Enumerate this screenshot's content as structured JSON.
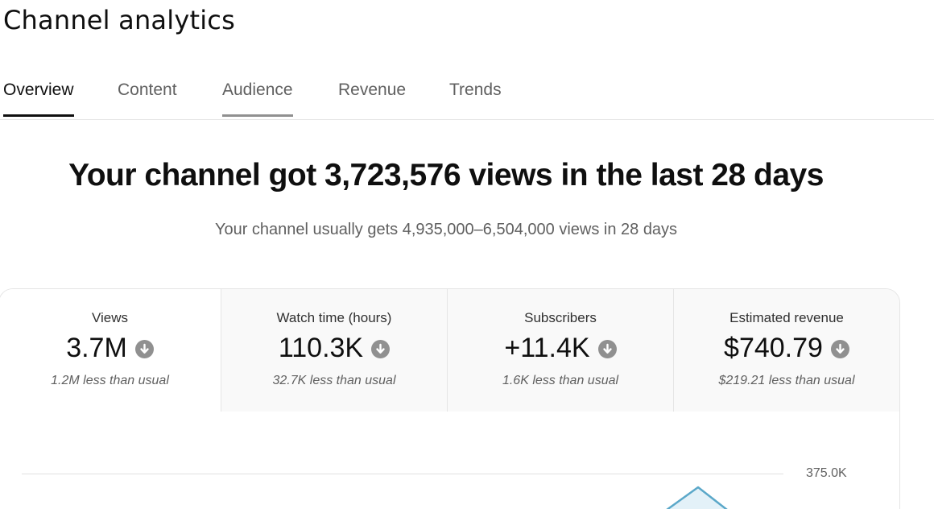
{
  "header": {
    "title": "Channel analytics"
  },
  "tabs": [
    {
      "label": "Overview"
    },
    {
      "label": "Content"
    },
    {
      "label": "Audience"
    },
    {
      "label": "Revenue"
    },
    {
      "label": "Trends"
    }
  ],
  "summary": {
    "headline": "Your channel got 3,723,576 views in the last 28 days",
    "subline": "Your channel usually gets 4,935,000–6,504,000 views in 28 days"
  },
  "metrics": [
    {
      "label": "Views",
      "value": "3.7M",
      "compare": "1.2M less than usual",
      "trend_icon": "arrow-down-circle-icon"
    },
    {
      "label": "Watch time (hours)",
      "value": "110.3K",
      "compare": "32.7K less than usual",
      "trend_icon": "arrow-down-circle-icon"
    },
    {
      "label": "Subscribers",
      "value": "+11.4K",
      "compare": "1.6K less than usual",
      "trend_icon": "arrow-down-circle-icon"
    },
    {
      "label": "Estimated revenue",
      "value": "$740.79",
      "compare": "$219.21 less than usual",
      "trend_icon": "arrow-down-circle-icon"
    }
  ],
  "chart": {
    "y_tick_label": "375.0K",
    "line_color": "#5ba8c9",
    "fill_color": "#e3f1f8"
  },
  "colors": {
    "text_primary": "#0f0f0f",
    "text_secondary": "#606060",
    "divider": "#e5e5e5",
    "card_inactive_bg": "#f9f9f9",
    "icon_gray": "#909090"
  }
}
